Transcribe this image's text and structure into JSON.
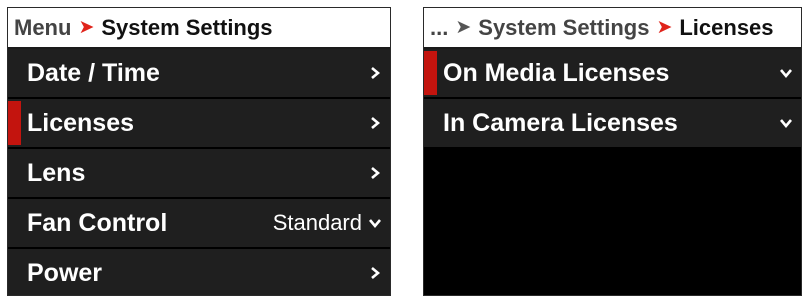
{
  "left_panel": {
    "breadcrumb": {
      "parent": "Menu",
      "current": "System Settings"
    },
    "items": [
      {
        "label": "Date / Time",
        "value": "",
        "icon": "chevron-right-icon",
        "selected": false
      },
      {
        "label": "Licenses",
        "value": "",
        "icon": "chevron-right-icon",
        "selected": true
      },
      {
        "label": "Lens",
        "value": "",
        "icon": "chevron-right-icon",
        "selected": false
      },
      {
        "label": "Fan Control",
        "value": "Standard",
        "icon": "chevron-down-icon",
        "selected": false
      },
      {
        "label": "Power",
        "value": "",
        "icon": "chevron-right-icon",
        "selected": false
      }
    ]
  },
  "right_panel": {
    "breadcrumb": {
      "ellipsis": "...",
      "parent": "System Settings",
      "current": "Licenses"
    },
    "items": [
      {
        "label": "On Media Licenses",
        "icon": "chevron-down-icon",
        "selected": true
      },
      {
        "label": "In Camera Licenses",
        "icon": "chevron-down-icon",
        "selected": false
      }
    ]
  },
  "colors": {
    "accent_red": "#c3140e",
    "breadcrumb_arrow_red": "#e0241b",
    "row_background": "#1f1f1f",
    "panel_background": "#000000"
  }
}
